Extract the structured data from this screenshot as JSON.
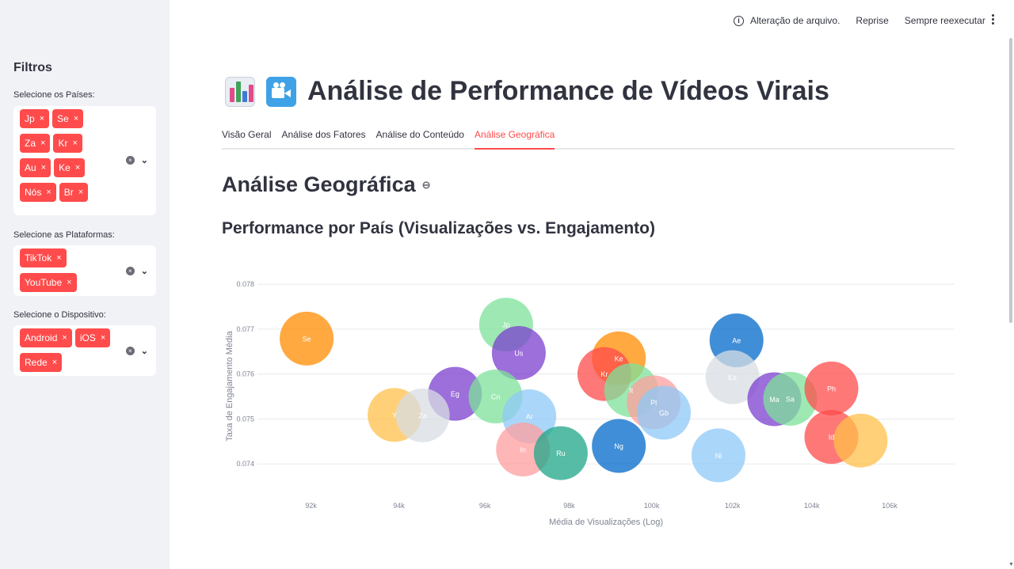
{
  "sidebar": {
    "title": "Filtros",
    "countries_label": "Selecione os Países:",
    "countries": [
      "Jp",
      "Se",
      "Za",
      "Kr",
      "Au",
      "Ke",
      "Nós",
      "Br"
    ],
    "platforms_label": "Selecione as Plataformas:",
    "platforms": [
      "TikTok",
      "YouTube"
    ],
    "devices_label": "Selecione o Dispositivo:",
    "devices": [
      "Android",
      "iOS",
      "Rede"
    ],
    "remove_glyph": "×",
    "clear_glyph": "×",
    "chevron_glyph": "⌄"
  },
  "toolbar": {
    "info_glyph": "i",
    "status": "Alteração de arquivo.",
    "rerun": "Reprise",
    "always_rerun": "Sempre reexecutar"
  },
  "header": {
    "title": "Análise de Performance de Vídeos Virais"
  },
  "tabs": [
    "Visão Geral",
    "Análise dos Fatores",
    "Análise do Conteúdo",
    "Análise Geográfica"
  ],
  "active_tab": "Análise Geográfica",
  "main": {
    "section_title": "Análise Geográfica",
    "link_glyph": "⊖",
    "subtitle": "Performance por País (Visualizações vs. Engajamento)"
  },
  "colors": {
    "accent": "#FF4B4B",
    "sidebar_bg": "#F0F2F6"
  },
  "chart_data": {
    "type": "scatter",
    "xlabel": "Média de Visualizações (Log)",
    "ylabel": "Taxa de Engajamento Média",
    "x_ticks": [
      92000,
      94000,
      96000,
      98000,
      100000,
      102000,
      104000,
      106000
    ],
    "x_tick_labels": [
      "92k",
      "94k",
      "96k",
      "98k",
      "100k",
      "102k",
      "104k",
      "106k"
    ],
    "y_ticks": [
      0.074,
      0.075,
      0.076,
      0.077,
      0.078
    ],
    "y_tick_labels": [
      "0.074",
      "0.075",
      "0.076",
      "0.077",
      "0.078"
    ],
    "xlim": [
      90800,
      107700
    ],
    "ylim": [
      0.07344,
      0.07802
    ],
    "log_x": true,
    "grid": true,
    "points": [
      {
        "label": "Se",
        "x": 91900,
        "y": 0.07679,
        "color": "#FF8C00"
      },
      {
        "label": "Jp",
        "x": 96500,
        "y": 0.0771,
        "color": "#7EE29A"
      },
      {
        "label": "Us",
        "x": 96800,
        "y": 0.07647,
        "color": "#7B3FCF"
      },
      {
        "label": "Eg",
        "x": 95300,
        "y": 0.07556,
        "color": "#7B3FCF"
      },
      {
        "label": "Cn",
        "x": 96250,
        "y": 0.0755,
        "color": "#7EE29A"
      },
      {
        "label": "Y",
        "x": 93900,
        "y": 0.07509,
        "color": "#FFC04A"
      },
      {
        "label": "Za",
        "x": 94550,
        "y": 0.07508,
        "color": "#D8DDE3"
      },
      {
        "label": "Ar",
        "x": 97050,
        "y": 0.07506,
        "color": "#8EC8F7"
      },
      {
        "label": "In",
        "x": 96900,
        "y": 0.07432,
        "color": "#FF9E9E"
      },
      {
        "label": "Ru",
        "x": 97800,
        "y": 0.07424,
        "color": "#1FA688"
      },
      {
        "label": "Ke",
        "x": 99200,
        "y": 0.07635,
        "color": "#FF8C00"
      },
      {
        "label": "Kr",
        "x": 98850,
        "y": 0.076,
        "color": "#FF4B4B"
      },
      {
        "label": "It",
        "x": 99500,
        "y": 0.07564,
        "color": "#7EE29A"
      },
      {
        "label": "Pl",
        "x": 100050,
        "y": 0.07537,
        "color": "#FF9E9E"
      },
      {
        "label": "Gb",
        "x": 100300,
        "y": 0.07514,
        "color": "#8EC8F7"
      },
      {
        "label": "Ng",
        "x": 99200,
        "y": 0.0744,
        "color": "#0068C9"
      },
      {
        "label": "Ae",
        "x": 102100,
        "y": 0.07675,
        "color": "#0068C9"
      },
      {
        "label": "Es",
        "x": 102000,
        "y": 0.07593,
        "color": "#D8DDE3"
      },
      {
        "label": "Nl",
        "x": 101650,
        "y": 0.07419,
        "color": "#8EC8F7"
      },
      {
        "label": "Ma",
        "x": 103050,
        "y": 0.07544,
        "color": "#7B3FCF"
      },
      {
        "label": "Sa",
        "x": 103450,
        "y": 0.07545,
        "color": "#7EE29A"
      },
      {
        "label": "Ph",
        "x": 104500,
        "y": 0.07568,
        "color": "#FF4B4B"
      },
      {
        "label": "Id",
        "x": 104500,
        "y": 0.0746,
        "color": "#FF4B4B"
      },
      {
        "label": "",
        "x": 105250,
        "y": 0.07452,
        "color": "#FFC04A"
      }
    ]
  }
}
